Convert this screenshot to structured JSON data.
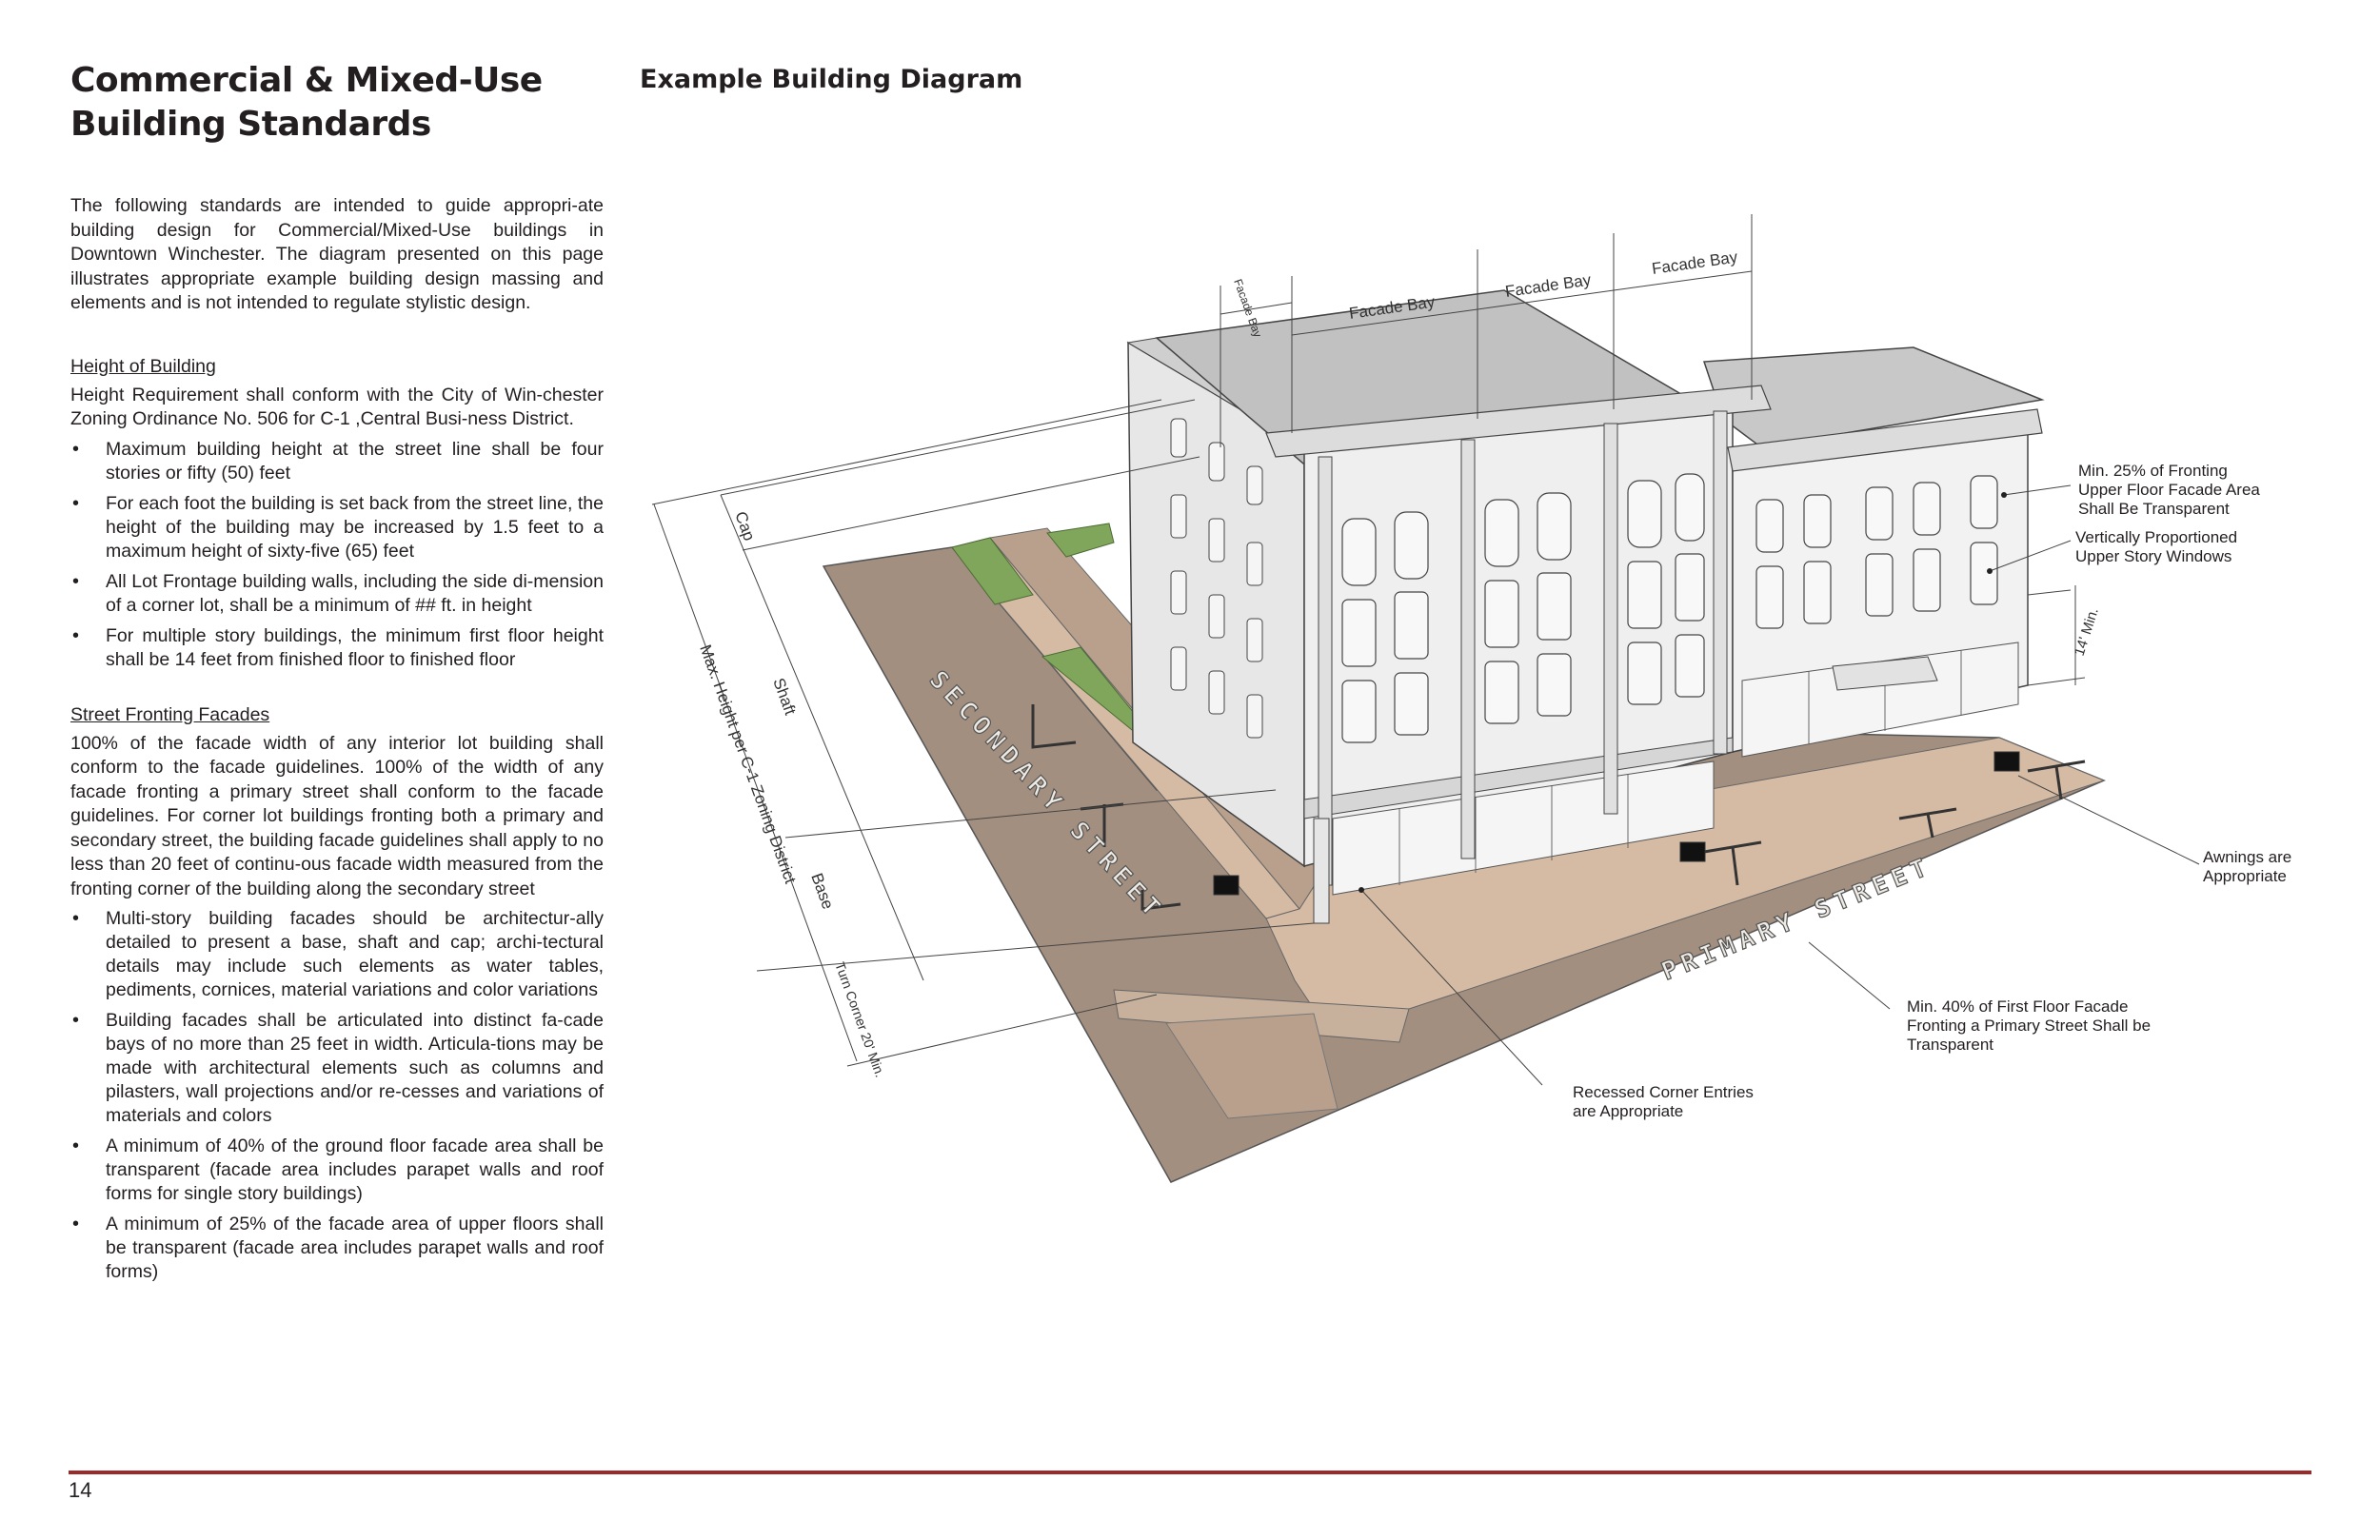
{
  "page": {
    "title_line1": "Commercial & Mixed-Use",
    "title_line2": "Building Standards",
    "intro": "The following standards are intended to guide appropri-ate building design for Commercial/Mixed-Use buildings in Downtown Winchester. The diagram presented on this page illustrates appropriate example building design massing and elements and is not intended to regulate stylistic design.",
    "page_number": "14"
  },
  "height_section": {
    "title": "Height of Building",
    "intro": "Height Requirement shall conform with the City of Win-chester Zoning Ordinance No. 506 for C-1 ,Central Busi-ness District.",
    "bullets": [
      "Maximum building height at the street line shall be four stories or fifty (50) feet",
      "For each foot the building is set back from the street line, the height of the building may be increased by 1.5 feet to a maximum height of sixty-five (65) feet",
      "All Lot Frontage building walls, including the side di-mension of a corner lot, shall be a minimum of ## ft. in height",
      "For multiple story buildings, the minimum first floor height shall be 14 feet from finished floor to finished floor"
    ]
  },
  "facade_section": {
    "title": "Street Fronting Facades",
    "intro": "100% of the facade width of any interior lot building shall conform to the facade guidelines. 100% of the width of any facade fronting a primary street shall conform to the facade guidelines. For corner lot buildings fronting both a primary and secondary street, the building facade guidelines shall apply to no less than 20 feet of continu-ous facade width measured from the fronting corner of the building along the secondary street",
    "bullets": [
      "Multi-story building facades should be architectur-ally detailed to present a base, shaft and cap; archi-tectural details may include such elements as water tables, pediments, cornices, material variations and color variations",
      "Building facades shall be articulated into distinct fa-cade bays of no more than 25 feet in width. Articula-tions may be made with architectural elements such as columns and pilasters, wall projections and/or re-cesses and variations of materials and colors",
      "A minimum of 40% of the ground floor facade area shall be transparent (facade area includes parapet walls and roof forms for single story buildings)",
      "A minimum of 25% of the facade area of upper floors shall be transparent (facade area includes parapet walls and roof forms)"
    ]
  },
  "diagram": {
    "title": "Example Building Diagram",
    "street_secondary": "SECONDARY STREET",
    "street_primary": "PRIMARY STREET",
    "dim_labels": {
      "facade_bay_small": "Facade Bay",
      "facade_bay_1": "Facade Bay",
      "facade_bay_2": "Facade Bay",
      "facade_bay_3": "Facade Bay",
      "cap": "Cap",
      "shaft": "Shaft",
      "base": "Base",
      "max_height": "Max. Height per C-1 Zoning District",
      "turn_corner": "Turn Corner 20' Min.",
      "fourteen_min": "14' Min."
    },
    "callouts": {
      "upper_transparent_1": "Min. 25% of Fronting",
      "upper_transparent_2": "Upper Floor Facade Area",
      "upper_transparent_3": "Shall Be Transparent",
      "windows_1": "Vertically Proportioned",
      "windows_2": "Upper Story Windows",
      "awnings_1": "Awnings are",
      "awnings_2": "Appropriate",
      "first_floor_1": "Min. 40% of First Floor Facade",
      "first_floor_2": "Fronting a Primary Street Shall be",
      "first_floor_3": "Transparent",
      "corner_1": "Recessed Corner Entries",
      "corner_2": "are Appropriate"
    }
  }
}
